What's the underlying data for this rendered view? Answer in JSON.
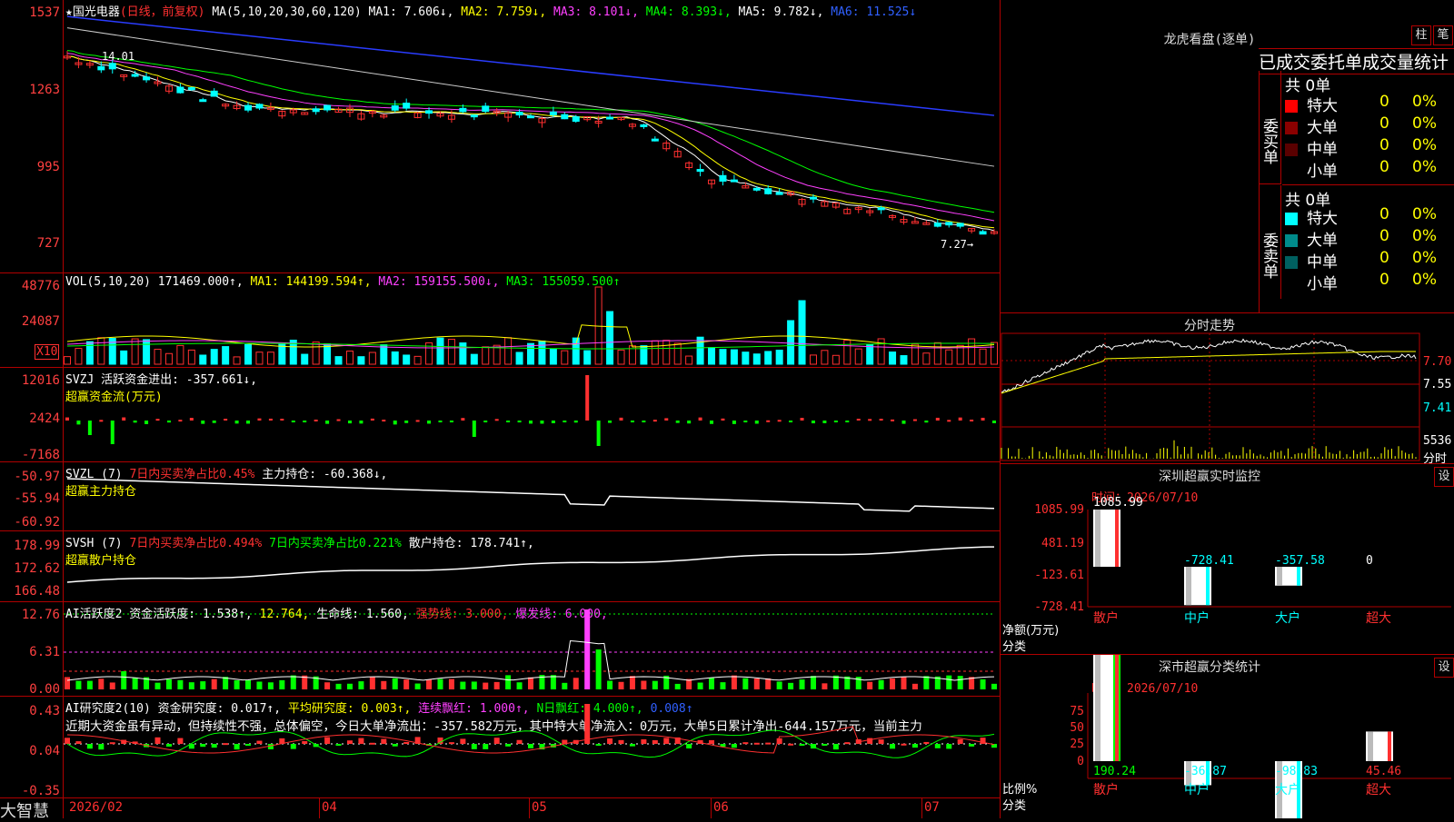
{
  "brand": "大智慧",
  "xaxis": {
    "ticks": [
      "2026/02",
      "04",
      "05",
      "06",
      "07"
    ]
  },
  "price_pane": {
    "title": "★国光电器",
    "mode": "(日线，前复权)",
    "ma_label": "MA(5,10,20,30,60,120)",
    "ma1": "MA1: 7.606↓,",
    "ma2": "MA2: 7.759↓,",
    "ma3": "MA3: 8.101↓,",
    "ma4": "MA4: 8.393↓,",
    "ma5": "MA5: 9.782↓,",
    "ma6": "MA6: 11.525↓",
    "yticks": [
      "1537",
      "1263",
      "995",
      "727"
    ],
    "high_label": "14.01",
    "low_label": "7.27→"
  },
  "vol_pane": {
    "label": "VOL(5,10,20)",
    "value": "171469.000↑,",
    "ma1": "MA1: 144199.594↑,",
    "ma2": "MA2: 159155.500↓,",
    "ma3": "MA3: 155059.500↑",
    "yticks": [
      "48776",
      "24087"
    ],
    "unit": "X10"
  },
  "svzj_pane": {
    "label": "SVZJ  活跃资金进出: -357.661↓,",
    "sub": "超赢资金流(万元)",
    "yticks": [
      "12016",
      "2424",
      "-7168"
    ]
  },
  "svzl_pane": {
    "label": "SVZL (7)",
    "pct": "7日内买卖净占比0.45%",
    "hold": "主力持仓: -60.368↓,",
    "sub": "超赢主力持仓",
    "yticks": [
      "-50.97",
      "-55.94",
      "-60.92"
    ]
  },
  "svsh_pane": {
    "label": "SVSH (7)",
    "pct1": "7日内买卖净占比0.494%",
    "pct2": "7日内买卖净占比0.221%",
    "hold": "散户持仓: 178.741↑,",
    "sub": "超赢散户持仓",
    "yticks": [
      "178.99",
      "172.62",
      "166.48"
    ]
  },
  "active_pane": {
    "label": "AI活跃度2 资金活跃度: 1.538↑,",
    "v2": "12.764,",
    "life": "生命线: 1.560,",
    "strong": "强势线: 3.000,",
    "burst": "爆发线: 6.000,",
    "yticks": [
      "12.76",
      "6.31",
      "0.00"
    ]
  },
  "research_pane": {
    "label": "AI研究度2(10) 资金研究度: 0.017↑,",
    "avg": "平均研究度: 0.003↑,",
    "cont": "连续飘红: 1.000↑,",
    "nday": "N日飘红: 4.000↑,",
    "last": "0.008↑",
    "commentary": "近期大资金虽有异动，但持续性不强，总体偏空，今日大单净流出：-357.582万元，其中特大单净流入：0万元，大单5日累计净出-644.157万元，当前主力",
    "yticks": [
      "0.43",
      "0.04",
      "-0.35"
    ]
  },
  "longhu": {
    "title": "龙虎看盘(逐单)",
    "btn1": "柱",
    "btn2": "笔",
    "header": "已成交委托单成交量统计",
    "buy_total": "共 0单",
    "sell_total": "共 0单",
    "buy_side": "委买单",
    "sell_side": "委卖单",
    "buy_rows": [
      {
        "name": "特大",
        "color": "#ff0000",
        "n": "0",
        "p": "0%"
      },
      {
        "name": "大单",
        "color": "#8b0000",
        "n": "0",
        "p": "0%"
      },
      {
        "name": "中单",
        "color": "#5a0000",
        "n": "0",
        "p": "0%"
      },
      {
        "name": "小单",
        "color": "#000000",
        "n": "0",
        "p": "0%"
      }
    ],
    "sell_rows": [
      {
        "name": "特大",
        "color": "#00ffff",
        "n": "0",
        "p": "0%"
      },
      {
        "name": "大单",
        "color": "#008b8b",
        "n": "0",
        "p": "0%"
      },
      {
        "name": "中单",
        "color": "#006060",
        "n": "0",
        "p": "0%"
      },
      {
        "name": "小单",
        "color": "#000000",
        "n": "0",
        "p": "0%"
      }
    ]
  },
  "intraday": {
    "title": "分时走势",
    "yticks": [
      "7.70",
      "7.55",
      "7.41"
    ],
    "vol_tick": "5536",
    "unit": "分时"
  },
  "monitor": {
    "title": "深圳超赢实时监控",
    "btn": "设",
    "time": "时间：2026/07/10",
    "yticks": [
      "1085.99",
      "481.19",
      "-123.61",
      "-728.41"
    ],
    "ylabel": "净额(万元)",
    "xlabel": "分类",
    "cats": [
      "散户",
      "中户",
      "大户",
      "超大"
    ],
    "values": [
      1085.99,
      -728.41,
      -357.58,
      0
    ],
    "labels": [
      "1085.99",
      "-728.41",
      "-357.58",
      "0"
    ]
  },
  "classify": {
    "title": "深市超赢分类统计",
    "btn": "设",
    "time": "时间：2026/07/10",
    "yticks": [
      "75",
      "50",
      "25",
      "0"
    ],
    "ylabel": "比例%",
    "xlabel": "分类",
    "cats": [
      "散户",
      "中户",
      "大户",
      "超大"
    ],
    "values": [
      190.24,
      -36.87,
      -98.83,
      45.46
    ],
    "labels": [
      "190.24",
      "-36.87",
      "-98.83",
      "45.46"
    ]
  }
}
